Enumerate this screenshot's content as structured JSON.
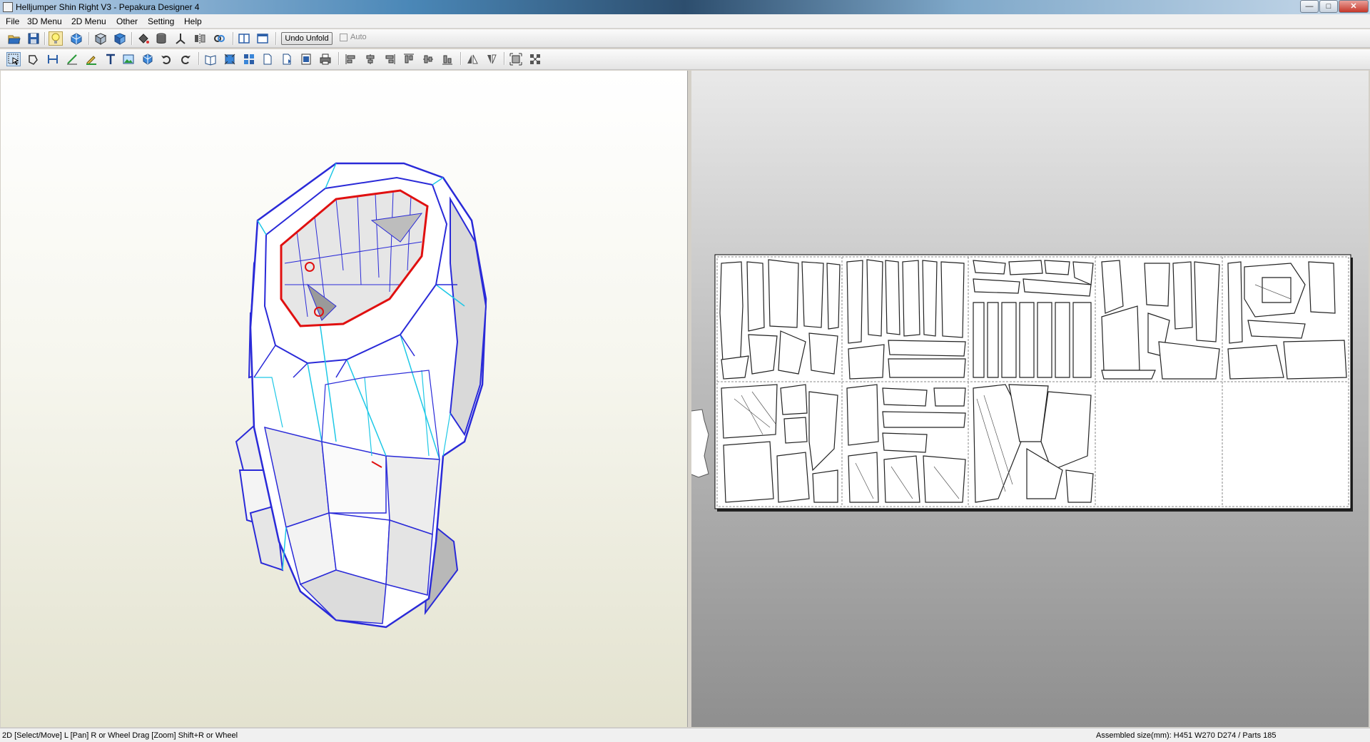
{
  "window": {
    "title": "Helljumper Shin Right V3 - Pepakura Designer 4",
    "controls": {
      "minimize": "—",
      "maximize": "□",
      "close": "✕"
    }
  },
  "menu": {
    "items": [
      "File",
      "3D Menu",
      "2D Menu",
      "Other",
      "Setting",
      "Help"
    ]
  },
  "toolbar1": {
    "undo_unfold": "Undo Unfold",
    "auto_label": "Auto",
    "auto_checked": false,
    "icons": [
      "open-icon",
      "save-icon",
      "light-icon",
      "texture-icon",
      "edge-icon",
      "unfold-icon",
      "paint-icon",
      "cylinder-icon",
      "axis-icon",
      "mirror-icon",
      "link-icon",
      "split-view-icon",
      "single-view-icon"
    ]
  },
  "toolbar2": {
    "icons": [
      "select-tool-icon",
      "rotate-part-icon",
      "join-edge-icon",
      "fold-line-icon",
      "edge-edit-icon",
      "text-icon",
      "image-icon",
      "move-3d-icon",
      "undo-icon",
      "redo-icon",
      "open-book-icon",
      "fit-icon",
      "arrange-icon",
      "page-icon",
      "page-add-icon",
      "print-setup-icon",
      "print-icon",
      "align-left-icon",
      "align-center-icon",
      "align-right-icon",
      "align-top-icon",
      "align-middle-icon",
      "align-bottom-icon",
      "flip-icon",
      "flip-vertical-icon",
      "fit-page-icon",
      "scatter-icon"
    ]
  },
  "view2d": {
    "pages_rows": 2,
    "pages_cols": 5,
    "empty_pages": 2
  },
  "status": {
    "hint": "2D [Select/Move] L [Pan] R or Wheel Drag [Zoom] Shift+R or Wheel",
    "info": "Assembled size(mm): H451 W270 D274 / Parts 185"
  },
  "colors": {
    "mesh_edge": "#2a2ad8",
    "mesh_fold": "#1ec8e6",
    "selection": "#e01010",
    "background_3d": "#f6f6ee"
  }
}
